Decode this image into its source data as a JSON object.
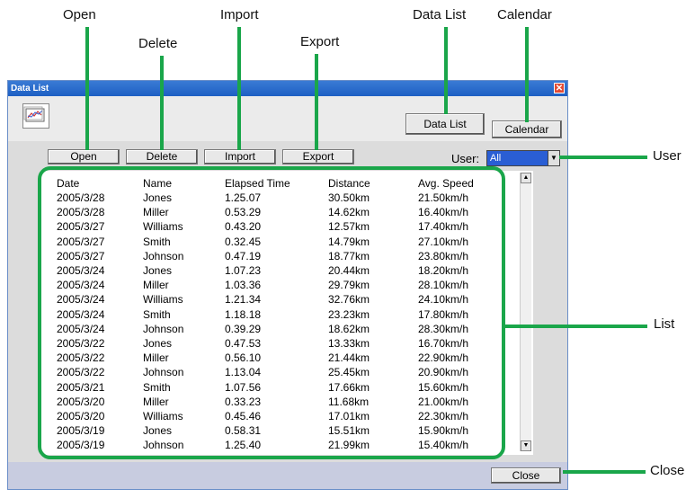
{
  "annotations": {
    "open": "Open",
    "delete": "Delete",
    "import": "Import",
    "export": "Export",
    "data_list": "Data List",
    "calendar": "Calendar",
    "user": "User",
    "list": "List",
    "close": "Close"
  },
  "window": {
    "title": "Data List",
    "close_glyph": "✕"
  },
  "toolbar": {
    "open": "Open",
    "delete": "Delete",
    "import": "Import",
    "export": "Export",
    "data_list": "Data List",
    "calendar": "Calendar"
  },
  "user": {
    "label": "User:",
    "selected": "All"
  },
  "table": {
    "headers": [
      "Date",
      "Name",
      "Elapsed Time",
      "Distance",
      "Avg. Speed"
    ],
    "rows": [
      [
        "2005/3/28",
        "Jones",
        "1.25.07",
        "30.50km",
        "21.50km/h"
      ],
      [
        "2005/3/28",
        "Miller",
        "0.53.29",
        "14.62km",
        "16.40km/h"
      ],
      [
        "2005/3/27",
        "Williams",
        "0.43.20",
        "12.57km",
        "17.40km/h"
      ],
      [
        "2005/3/27",
        "Smith",
        "0.32.45",
        "14.79km",
        "27.10km/h"
      ],
      [
        "2005/3/27",
        "Johnson",
        "0.47.19",
        "18.77km",
        "23.80km/h"
      ],
      [
        "2005/3/24",
        "Jones",
        "1.07.23",
        "20.44km",
        "18.20km/h"
      ],
      [
        "2005/3/24",
        "Miller",
        "1.03.36",
        "29.79km",
        "28.10km/h"
      ],
      [
        "2005/3/24",
        "Williams",
        "1.21.34",
        "32.76km",
        "24.10km/h"
      ],
      [
        "2005/3/24",
        "Smith",
        "1.18.18",
        "23.23km",
        "17.80km/h"
      ],
      [
        "2005/3/24",
        "Johnson",
        "0.39.29",
        "18.62km",
        "28.30km/h"
      ],
      [
        "2005/3/22",
        "Jones",
        "0.47.53",
        "13.33km",
        "16.70km/h"
      ],
      [
        "2005/3/22",
        "Miller",
        "0.56.10",
        "21.44km",
        "22.90km/h"
      ],
      [
        "2005/3/22",
        "Johnson",
        "1.13.04",
        "25.45km",
        "20.90km/h"
      ],
      [
        "2005/3/21",
        "Smith",
        "1.07.56",
        "17.66km",
        "15.60km/h"
      ],
      [
        "2005/3/20",
        "Miller",
        "0.33.23",
        "11.68km",
        "21.00km/h"
      ],
      [
        "2005/3/20",
        "Williams",
        "0.45.46",
        "17.01km",
        "22.30km/h"
      ],
      [
        "2005/3/19",
        "Jones",
        "0.58.31",
        "15.51km",
        "15.90km/h"
      ],
      [
        "2005/3/19",
        "Johnson",
        "1.25.40",
        "21.99km",
        "15.40km/h"
      ]
    ]
  },
  "footer": {
    "close": "Close"
  },
  "colors": {
    "accent_green": "#1aa64a",
    "title_blue": "#2a5ed4"
  }
}
